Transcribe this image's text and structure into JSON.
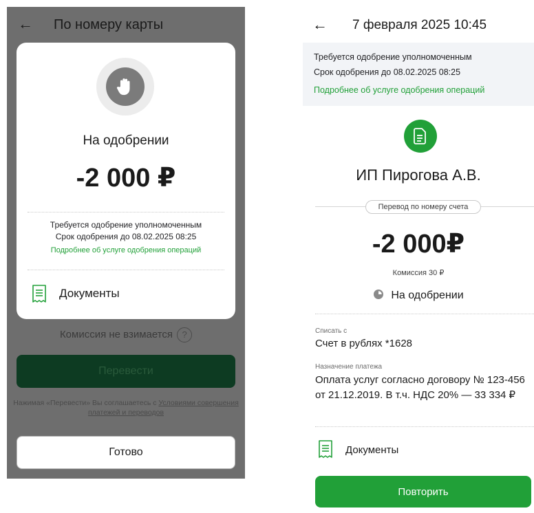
{
  "left": {
    "header": {
      "back_icon": "←",
      "title": "По номеру карты"
    },
    "modal": {
      "status_icon": "hand-stop-icon",
      "status": "На одобрении",
      "amount": "-2 000 ₽",
      "notice_line1": "Требуется одобрение уполномоченным",
      "notice_line2": "Срок одобрения до 08.02.2025 08:25",
      "notice_link": "Подробнее об услуге одобрения операций",
      "documents_label": "Документы"
    },
    "fee": "Комиссия не взимается",
    "fee_help": "?",
    "transfer_label": "Перевести",
    "terms_prefix": "Нажимая «Перевести» Вы соглашаетесь с ",
    "terms_link": "Условиями совершения платежей и переводов",
    "done_label": "Готово"
  },
  "right": {
    "header": {
      "back_icon": "←",
      "title": "7 февраля 2025 10:45"
    },
    "notice": {
      "line1": "Требуется одобрение уполномоченным",
      "line2": "Срок одобрения до 08.02.2025 08:25",
      "link": "Подробнее об услуге одобрения операций"
    },
    "recipient": "ИП Пирогова А.В.",
    "transfer_type": "Перевод по номеру счета",
    "amount": "-2 000₽",
    "commission": "Комиссия 30 ₽",
    "status": "На одобрении",
    "debit_label": "Списать с",
    "debit_value": "Счет в рублях *1628",
    "purpose_label": "Назначение платежа",
    "purpose_value": "Оплата услуг согласно договору № 123-456 от 21.12.2019. В т.ч. НДС 20% — 33 334 ₽",
    "documents_label": "Документы",
    "repeat_label": "Повторить"
  },
  "colors": {
    "accent": "#21a038",
    "dim_overlay": "#6e6e6e",
    "notice_bg": "#f2f4f7"
  }
}
